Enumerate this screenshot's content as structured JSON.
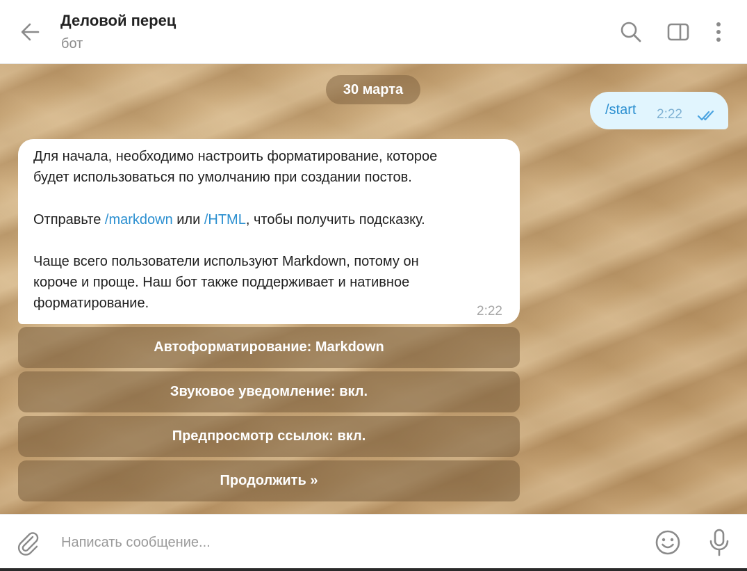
{
  "header": {
    "title": "Деловой перец",
    "subtitle": "бот"
  },
  "icons": {
    "back": "arrow-left-icon",
    "search": "search-icon",
    "sidebar": "sidebar-panel-icon",
    "menu": "more-vertical-icon",
    "attach": "paperclip-icon",
    "emoji": "smile-icon",
    "mic": "microphone-icon",
    "read": "double-check-icon"
  },
  "colors": {
    "link": "#2b8fd0",
    "outgoing_bubble": "#e1f5fe",
    "incoming_bubble": "#ffffff",
    "keyboard_button": "#7a5c3c"
  },
  "chat": {
    "date": "30 марта",
    "outgoing": {
      "text": "/start",
      "time": "2:22"
    },
    "incoming": {
      "line1": "Для начала, необходимо настроить форматирование, которое",
      "line2": "будет использоваться по умолчанию при создании постов.",
      "line3_before": "Отправьте ",
      "line3_link1": "/markdown",
      "line3_mid": " или ",
      "line3_link2": "/HTML",
      "line3_after": ", чтобы получить подсказку.",
      "line4": "Чаще всего пользователи используют Markdown, потому он",
      "line5": "короче и проще. Наш бот также поддерживает и нативное",
      "line6": "форматирование.",
      "time": "2:22"
    },
    "keyboard": [
      "Автоформатирование: Markdown",
      "Звуковое уведомление: вкл.",
      "Предпросмотр ссылок: вкл.",
      "Продолжить »"
    ]
  },
  "composer": {
    "placeholder": "Написать сообщение..."
  }
}
